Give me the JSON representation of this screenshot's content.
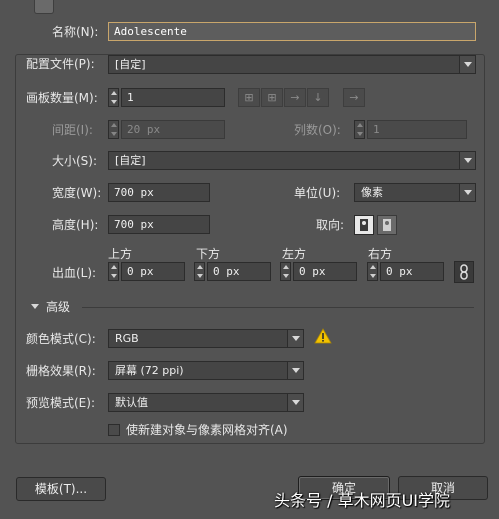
{
  "name": {
    "label": "名称(N):",
    "value": "Adolescente"
  },
  "profile": {
    "label": "配置文件(P):",
    "value": "[自定]"
  },
  "artboards": {
    "label": "画板数量(M):",
    "value": "1"
  },
  "spacing": {
    "label": "间距(I):",
    "value": "20 px"
  },
  "columns": {
    "label": "列数(O):",
    "value": "1"
  },
  "size": {
    "label": "大小(S):",
    "value": "[自定]"
  },
  "width": {
    "label": "宽度(W):",
    "value": "700 px"
  },
  "units": {
    "label": "单位(U):",
    "value": "像素"
  },
  "height": {
    "label": "高度(H):",
    "value": "700 px"
  },
  "orientation": {
    "label": "取向:"
  },
  "bleed": {
    "label": "出血(L):",
    "top_label": "上方",
    "top": "0 px",
    "bottom_label": "下方",
    "bottom": "0 px",
    "left_label": "左方",
    "left": "0 px",
    "right_label": "右方",
    "right": "0 px"
  },
  "advanced": {
    "label": "高级"
  },
  "color_mode": {
    "label": "颜色模式(C):",
    "value": "RGB"
  },
  "raster": {
    "label": "栅格效果(R):",
    "value": "屏幕 (72 ppi)"
  },
  "preview": {
    "label": "预览模式(E):",
    "value": "默认值"
  },
  "align_pixel": {
    "label": "使新建对象与像素网格对齐(A)",
    "checked": false
  },
  "buttons": {
    "templates": "模板(T)...",
    "ok": "确定",
    "cancel": "取消"
  },
  "watermark": "头条号 / 草木网页UI学院",
  "colors": {
    "bg": "#535353",
    "field": "#454545",
    "focus_border": "#c9a66b",
    "warning": "#f2c200"
  }
}
